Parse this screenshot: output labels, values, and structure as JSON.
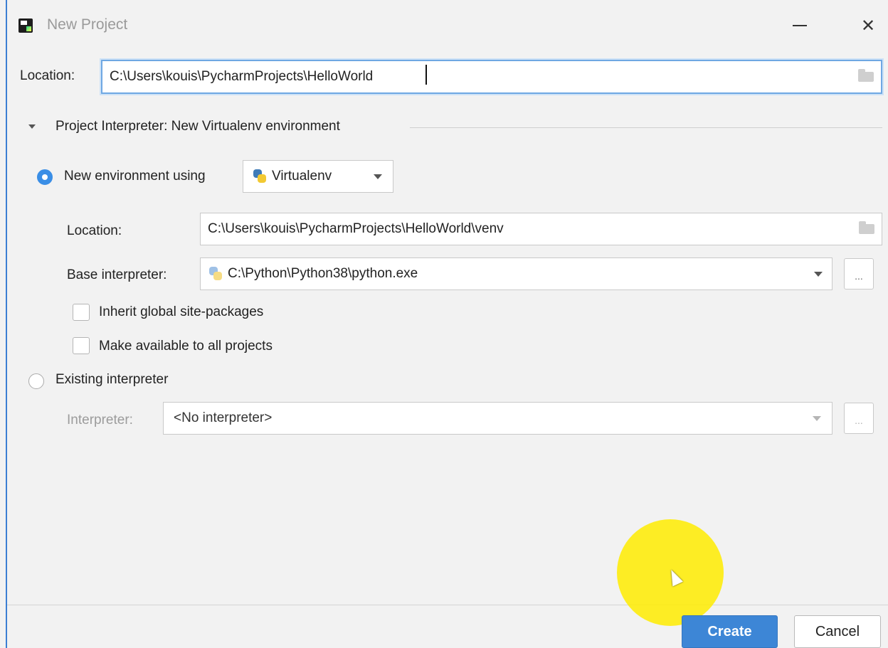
{
  "window": {
    "title": "New Project"
  },
  "location": {
    "label": "Location:",
    "value": "C:\\Users\\kouis\\PycharmProjects\\HelloWorld"
  },
  "interpreter_section": {
    "title": "Project Interpreter: New Virtualenv environment"
  },
  "new_env": {
    "label": "New environment using",
    "selected": true,
    "tool": "Virtualenv",
    "location_label": "Location:",
    "location_value": "C:\\Users\\kouis\\PycharmProjects\\HelloWorld\\venv",
    "base_label": "Base interpreter:",
    "base_value": "C:\\Python\\Python38\\python.exe",
    "inherit_label": "Inherit global site-packages",
    "inherit_checked": false,
    "available_label": "Make available to all projects",
    "available_checked": false
  },
  "existing": {
    "label": "Existing interpreter",
    "selected": false,
    "interpreter_label": "Interpreter:",
    "interpreter_value": "<No interpreter>"
  },
  "buttons": {
    "browse": "...",
    "create": "Create",
    "cancel": "Cancel"
  },
  "colors": {
    "accent": "#3d86d6",
    "cursor_highlight": "#ffec00"
  },
  "icons": {
    "app": "pycharm-icon",
    "minimize": "minimize-icon",
    "close": "close-icon",
    "folder": "folder-icon",
    "python": "python-icon",
    "collapse": "triangle-down-icon"
  }
}
